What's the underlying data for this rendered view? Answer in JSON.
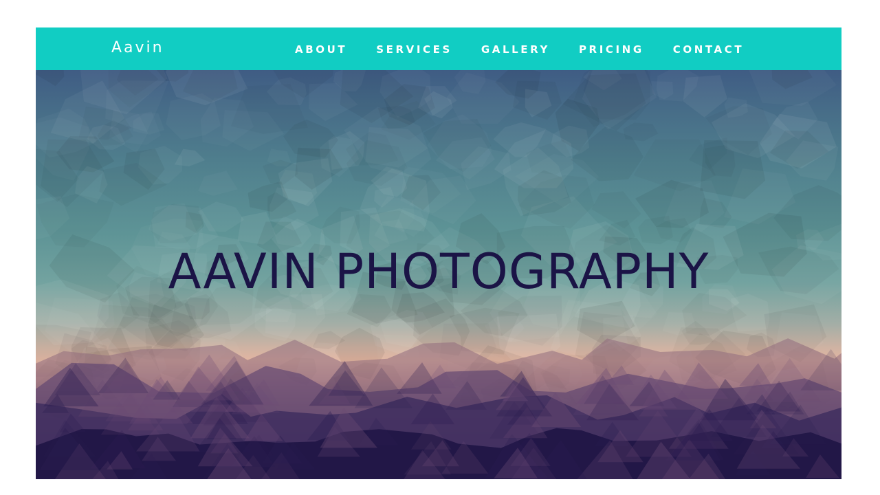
{
  "navbar": {
    "brand": "Aavin",
    "color": "#11cdc3",
    "links": [
      {
        "label": "ABOUT"
      },
      {
        "label": "SERVICES"
      },
      {
        "label": "GALLERY"
      },
      {
        "label": "PRICING"
      },
      {
        "label": "CONTACT"
      }
    ]
  },
  "hero": {
    "title": "AAVIN PHOTOGRAPHY",
    "title_color": "#1b1446",
    "background": "low-poly gradient: slate blue to teal to peach to deep purple"
  }
}
